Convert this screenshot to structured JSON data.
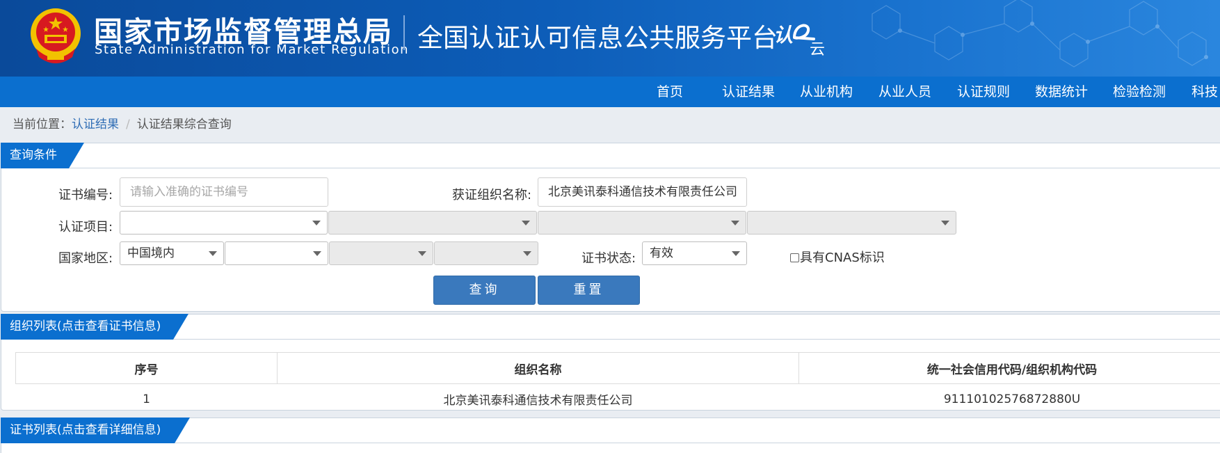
{
  "header": {
    "org_cn": "国家市场监督管理总局",
    "org_en": "State Administration for Market Regulation",
    "platform": "全国认证认可信息公共服务平台",
    "brand_mark_text": "认e云",
    "colors": {
      "banner": "#0d5db8",
      "nav": "#0b6fcf",
      "emblem": "#d71920",
      "gold": "#f2c200"
    }
  },
  "nav": {
    "items": [
      "首页",
      "认证结果",
      "从业机构",
      "从业人员",
      "认证规则",
      "数据统计",
      "检验检测",
      "科技"
    ]
  },
  "breadcrumb": {
    "prefix": "当前位置：",
    "link": "认证结果",
    "separator": "/",
    "current": "认证结果综合查询"
  },
  "query": {
    "title": "查询条件",
    "cert_no_label": "证书编号:",
    "cert_no_placeholder": "请输入准确的证书编号",
    "org_name_label": "获证组织名称:",
    "org_name_value": "北京美讯泰科通信技术有限责任公司",
    "project_label": "认证项目:",
    "region_label": "国家地区:",
    "region_value": "中国境内",
    "status_label": "证书状态:",
    "status_value": "有效",
    "cnas_label": "具有CNAS标识",
    "search_button": "查询",
    "reset_button": "重置"
  },
  "org_list": {
    "title": "组织列表(点击查看证书信息)",
    "columns": [
      "序号",
      "组织名称",
      "统一社会信用代码/组织机构代码"
    ],
    "rows": [
      {
        "index": "1",
        "name": "北京美讯泰科通信技术有限责任公司",
        "code": "91110102576872880U"
      }
    ]
  },
  "cert_list": {
    "title": "证书列表(点击查看详细信息)"
  }
}
